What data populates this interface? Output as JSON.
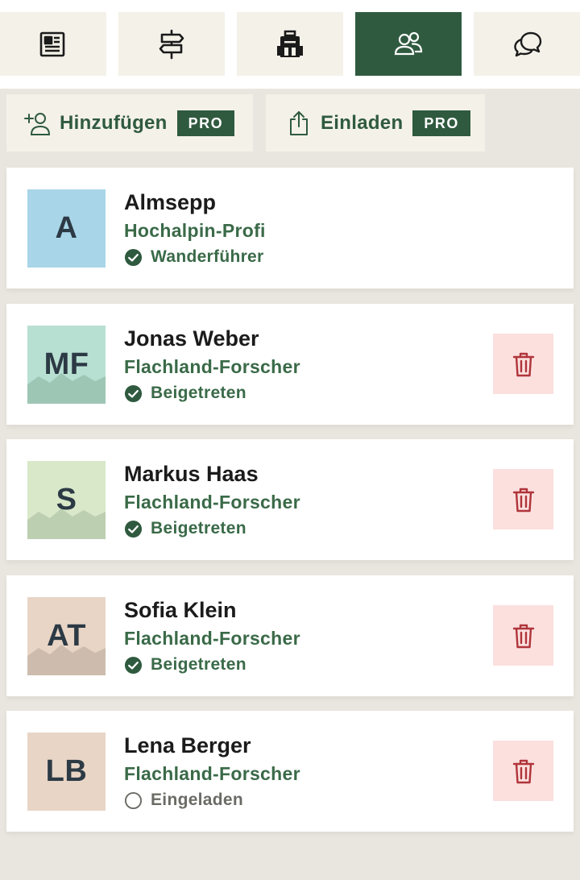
{
  "colors": {
    "accent_green": "#2f5a3f",
    "role_green": "#3a6a48",
    "delete_bg": "#fbe0de",
    "delete_icon": "#b0343a",
    "tab_bg": "#f4f1e9"
  },
  "tabs": [
    {
      "icon": "newspaper-icon",
      "active": false
    },
    {
      "icon": "signpost-icon",
      "active": false
    },
    {
      "icon": "backpack-icon",
      "active": false
    },
    {
      "icon": "users-icon",
      "active": true
    },
    {
      "icon": "chat-bubbles-icon",
      "active": false
    }
  ],
  "actions": {
    "add": {
      "label": "Hinzufügen",
      "badge": "PRO",
      "icon": "add-user-icon"
    },
    "invite": {
      "label": "Einladen",
      "badge": "PRO",
      "icon": "share-icon"
    }
  },
  "members": [
    {
      "initials": "A",
      "name": "Almsepp",
      "role": "Hochalpin-Profi",
      "status": "Wanderführer",
      "status_kind": "check",
      "avatar_color": "#a8d5e8",
      "mountains": false,
      "deletable": false
    },
    {
      "initials": "MF",
      "name": "Jonas Weber",
      "role": "Flachland-Forscher",
      "status": "Beigetreten",
      "status_kind": "check",
      "avatar_color": "#b8e0d2",
      "mountains": true,
      "mountain_color": "#9ec6b5",
      "deletable": true
    },
    {
      "initials": "S",
      "name": "Markus Haas",
      "role": "Flachland-Forscher",
      "status": "Beigetreten",
      "status_kind": "check",
      "avatar_color": "#d8e8c9",
      "mountains": true,
      "mountain_color": "#bccfb0",
      "deletable": true
    },
    {
      "initials": "AT",
      "name": "Sofia Klein",
      "role": "Flachland-Forscher",
      "status": "Beigetreten",
      "status_kind": "check",
      "avatar_color": "#e8d5c6",
      "mountains": true,
      "mountain_color": "#cdbcad",
      "deletable": true
    },
    {
      "initials": "LB",
      "name": "Lena Berger",
      "role": "Flachland-Forscher",
      "status": "Eingeladen",
      "status_kind": "pending",
      "avatar_color": "#e8d5c6",
      "mountains": false,
      "deletable": true
    }
  ]
}
